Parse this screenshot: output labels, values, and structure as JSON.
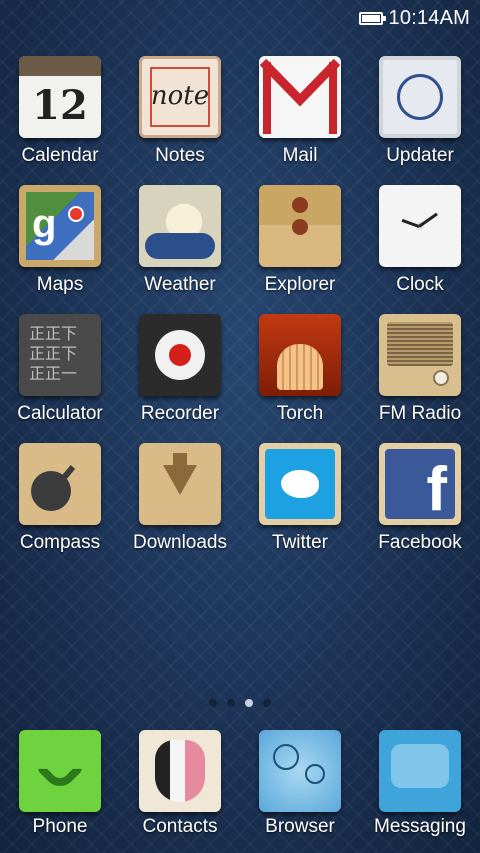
{
  "status_bar": {
    "time": "10:14AM"
  },
  "apps": [
    {
      "label": "Calendar",
      "icon": "calendar-icon",
      "icon_text": "12"
    },
    {
      "label": "Notes",
      "icon": "notes-icon",
      "icon_text": "note"
    },
    {
      "label": "Mail",
      "icon": "mail-icon"
    },
    {
      "label": "Updater",
      "icon": "updater-icon"
    },
    {
      "label": "Maps",
      "icon": "maps-icon",
      "icon_text": "g"
    },
    {
      "label": "Weather",
      "icon": "weather-icon"
    },
    {
      "label": "Explorer",
      "icon": "explorer-icon"
    },
    {
      "label": "Clock",
      "icon": "clock-icon"
    },
    {
      "label": "Calculator",
      "icon": "calculator-icon"
    },
    {
      "label": "Recorder",
      "icon": "recorder-icon"
    },
    {
      "label": "Torch",
      "icon": "torch-icon"
    },
    {
      "label": "FM Radio",
      "icon": "fm-radio-icon"
    },
    {
      "label": "Compass",
      "icon": "compass-icon"
    },
    {
      "label": "Downloads",
      "icon": "downloads-icon"
    },
    {
      "label": "Twitter",
      "icon": "twitter-icon"
    },
    {
      "label": "Facebook",
      "icon": "facebook-icon",
      "icon_text": "f"
    }
  ],
  "pager": {
    "pages": 4,
    "active": 2
  },
  "dock": [
    {
      "label": "Phone",
      "icon": "phone-icon"
    },
    {
      "label": "Contacts",
      "icon": "contacts-icon"
    },
    {
      "label": "Browser",
      "icon": "browser-icon"
    },
    {
      "label": "Messaging",
      "icon": "messaging-icon"
    }
  ],
  "colors": {
    "wallpaper": "#1d3556",
    "label_text": "#ffffff",
    "twitter_blue": "#1da1e3",
    "facebook_blue": "#3b5998",
    "phone_green": "#6ed33e"
  }
}
